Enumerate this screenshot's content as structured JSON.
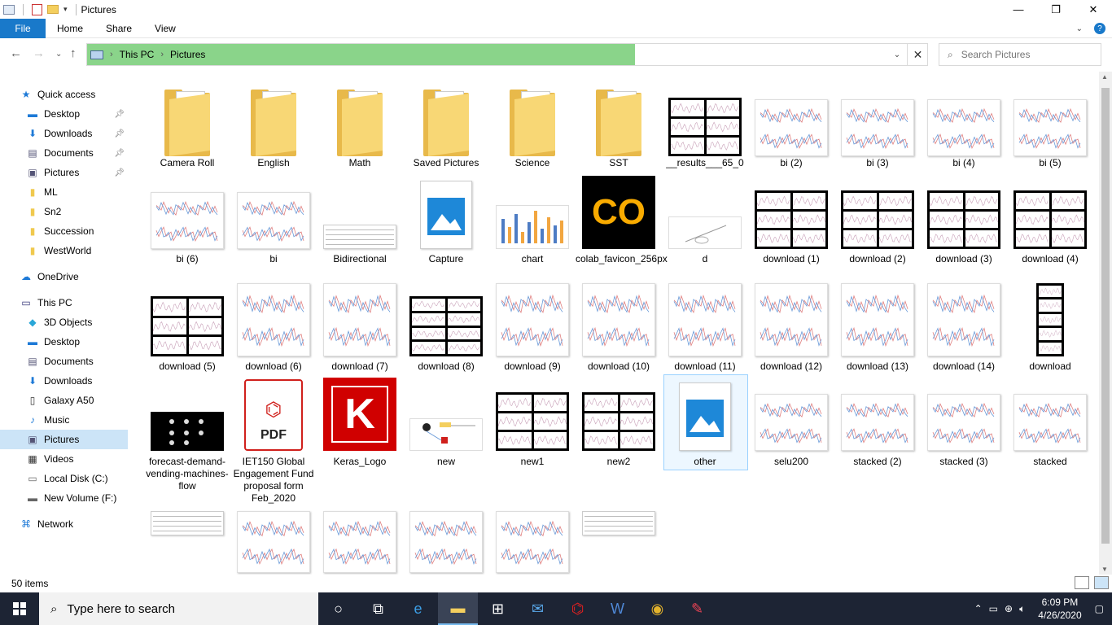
{
  "window": {
    "title": "Pictures",
    "minimize_glyph": "—",
    "restore_glyph": "❐",
    "close_glyph": "✕"
  },
  "ribbon": {
    "file": "File",
    "tabs": [
      "Home",
      "Share",
      "View"
    ]
  },
  "address": {
    "crumbs": [
      "This PC",
      "Pictures"
    ],
    "search_placeholder": "Search Pictures"
  },
  "sidebar": {
    "items": [
      {
        "label": "Quick access",
        "icon": "star-icon",
        "pinned": false,
        "level": 0
      },
      {
        "label": "Desktop",
        "icon": "desktop-icon",
        "pinned": true,
        "level": 1
      },
      {
        "label": "Downloads",
        "icon": "download-icon",
        "pinned": true,
        "level": 1
      },
      {
        "label": "Documents",
        "icon": "documents-icon",
        "pinned": true,
        "level": 1
      },
      {
        "label": "Pictures",
        "icon": "pictures-icon",
        "pinned": true,
        "level": 1
      },
      {
        "label": "ML",
        "icon": "folder-icon",
        "pinned": false,
        "level": 1
      },
      {
        "label": "Sn2",
        "icon": "folder-icon",
        "pinned": false,
        "level": 1
      },
      {
        "label": "Succession",
        "icon": "folder-icon",
        "pinned": false,
        "level": 1
      },
      {
        "label": "WestWorld",
        "icon": "folder-icon",
        "pinned": false,
        "level": 1
      },
      {
        "label": "OneDrive",
        "icon": "cloud-icon",
        "pinned": false,
        "level": 0
      },
      {
        "label": "This PC",
        "icon": "pc-icon",
        "pinned": false,
        "level": 0
      },
      {
        "label": "3D Objects",
        "icon": "cube-icon",
        "pinned": false,
        "level": 1
      },
      {
        "label": "Desktop",
        "icon": "desktop-icon",
        "pinned": false,
        "level": 1
      },
      {
        "label": "Documents",
        "icon": "documents-icon",
        "pinned": false,
        "level": 1
      },
      {
        "label": "Downloads",
        "icon": "download-icon",
        "pinned": false,
        "level": 1
      },
      {
        "label": "Galaxy A50",
        "icon": "phone-icon",
        "pinned": false,
        "level": 1
      },
      {
        "label": "Music",
        "icon": "music-icon",
        "pinned": false,
        "level": 1
      },
      {
        "label": "Pictures",
        "icon": "pictures-icon",
        "pinned": false,
        "level": 1,
        "selected": true
      },
      {
        "label": "Videos",
        "icon": "video-icon",
        "pinned": false,
        "level": 1
      },
      {
        "label": "Local Disk (C:)",
        "icon": "disk-icon",
        "pinned": false,
        "level": 1
      },
      {
        "label": "New Volume (F:)",
        "icon": "drive-icon",
        "pinned": false,
        "level": 1
      },
      {
        "label": "Network",
        "icon": "network-icon",
        "pinned": false,
        "level": 0
      }
    ]
  },
  "files": [
    {
      "label": "Camera Roll",
      "kind": "folder"
    },
    {
      "label": "English",
      "kind": "folder"
    },
    {
      "label": "Math",
      "kind": "folder"
    },
    {
      "label": "Saved Pictures",
      "kind": "folder"
    },
    {
      "label": "Science",
      "kind": "folder"
    },
    {
      "label": "SST",
      "kind": "folder"
    },
    {
      "label": "__results___65_0",
      "kind": "blackgrid"
    },
    {
      "label": "bi (2)",
      "kind": "chart"
    },
    {
      "label": "bi (3)",
      "kind": "chart"
    },
    {
      "label": "bi (4)",
      "kind": "chart"
    },
    {
      "label": "bi (5)",
      "kind": "chart"
    },
    {
      "label": "bi (6)",
      "kind": "chart"
    },
    {
      "label": "bi",
      "kind": "chart"
    },
    {
      "label": "Bidirectional",
      "kind": "table"
    },
    {
      "label": "Capture",
      "kind": "photo"
    },
    {
      "label": "chart",
      "kind": "barchart"
    },
    {
      "label": "colab_favicon_256px",
      "kind": "colab"
    },
    {
      "label": "d",
      "kind": "sketch"
    },
    {
      "label": "download (1)",
      "kind": "blackgrid"
    },
    {
      "label": "download (2)",
      "kind": "blackgrid"
    },
    {
      "label": "download (3)",
      "kind": "blackgrid"
    },
    {
      "label": "download (4)",
      "kind": "blackgrid"
    },
    {
      "label": "download (5)",
      "kind": "blackgrid"
    },
    {
      "label": "download (6)",
      "kind": "chart"
    },
    {
      "label": "download (7)",
      "kind": "chart"
    },
    {
      "label": "download (8)",
      "kind": "blackgrid"
    },
    {
      "label": "download (9)",
      "kind": "chart"
    },
    {
      "label": "download (10)",
      "kind": "chart"
    },
    {
      "label": "download (11)",
      "kind": "chart"
    },
    {
      "label": "download (12)",
      "kind": "chart"
    },
    {
      "label": "download (13)",
      "kind": "chart"
    },
    {
      "label": "download (14)",
      "kind": "chart"
    },
    {
      "label": "download",
      "kind": "blackgrid-tall"
    },
    {
      "label": "forecast-demand-vending-machines-flow",
      "kind": "forecast"
    },
    {
      "label": "IET150 Global Engagement Fund proposal form Feb_2020",
      "kind": "pdf"
    },
    {
      "label": "Keras_Logo",
      "kind": "keras"
    },
    {
      "label": "new",
      "kind": "diagram"
    },
    {
      "label": "new1",
      "kind": "blackgrid"
    },
    {
      "label": "new2",
      "kind": "blackgrid"
    },
    {
      "label": "other",
      "kind": "photo",
      "selected": true
    },
    {
      "label": "selu200",
      "kind": "chart"
    },
    {
      "label": "stacked (2)",
      "kind": "chart"
    },
    {
      "label": "stacked (3)",
      "kind": "chart"
    },
    {
      "label": "stacked",
      "kind": "chart"
    },
    {
      "label": "",
      "kind": "table"
    },
    {
      "label": "",
      "kind": "chart"
    },
    {
      "label": "",
      "kind": "chart"
    },
    {
      "label": "",
      "kind": "chart"
    },
    {
      "label": "",
      "kind": "chart"
    },
    {
      "label": "",
      "kind": "table"
    }
  ],
  "thumb_text": {
    "pdf": "PDF",
    "colab": "CO",
    "keras": "K"
  },
  "status": {
    "count": "50 items"
  },
  "taskbar": {
    "search_placeholder": "Type here to search",
    "time": "6:09 PM",
    "date": "4/26/2020"
  },
  "colors": {
    "accent": "#1979ca",
    "address_fill": "#8ad48a",
    "folder": "#f8d775",
    "taskbar": "#1d2434",
    "selection": "#cce4f7"
  }
}
